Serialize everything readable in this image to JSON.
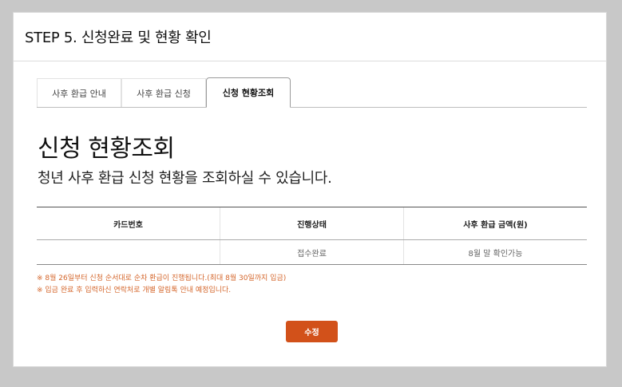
{
  "header": {
    "title": "STEP 5. 신청완료 및 현황 확인"
  },
  "tabs": [
    {
      "label": "사후 환급 안내",
      "active": false
    },
    {
      "label": "사후 환급 신청",
      "active": false
    },
    {
      "label": "신청 현황조회",
      "active": true
    }
  ],
  "main": {
    "heading": "신청 현황조회",
    "subheading": "청년 사후 환급 신청 현황을 조회하실 수 있습니다."
  },
  "table": {
    "columns": [
      "카드번호",
      "진행상태",
      "사후 환급 금액(원)"
    ],
    "rows": [
      [
        "",
        "접수완료",
        "8월 말 확인가능"
      ]
    ]
  },
  "notes": [
    "※ 8월 26일부터 신청 순서대로 순차 환급이 진행됩니다.(최대 8월 30일까지 입금)",
    "※ 입금 완료 후 입력하신 연락처로 개별 알림톡 안내 예정입니다."
  ],
  "actions": {
    "edit_label": "수정"
  },
  "colors": {
    "accent": "#d2511a",
    "note": "#d4652a"
  }
}
